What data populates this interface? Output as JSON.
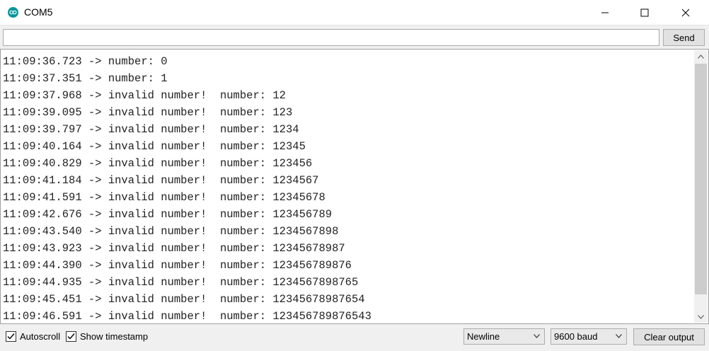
{
  "window": {
    "title": "COM5",
    "icon": "arduino-icon"
  },
  "send": {
    "input_value": "",
    "button_label": "Send"
  },
  "output": {
    "lines": [
      "11:09:36.723 -> number: 0",
      "11:09:37.351 -> number: 1",
      "11:09:37.968 -> invalid number!  number: 12",
      "11:09:39.095 -> invalid number!  number: 123",
      "11:09:39.797 -> invalid number!  number: 1234",
      "11:09:40.164 -> invalid number!  number: 12345",
      "11:09:40.829 -> invalid number!  number: 123456",
      "11:09:41.184 -> invalid number!  number: 1234567",
      "11:09:41.591 -> invalid number!  number: 12345678",
      "11:09:42.676 -> invalid number!  number: 123456789",
      "11:09:43.540 -> invalid number!  number: 1234567898",
      "11:09:43.923 -> invalid number!  number: 12345678987",
      "11:09:44.390 -> invalid number!  number: 123456789876",
      "11:09:44.935 -> invalid number!  number: 1234567898765",
      "11:09:45.451 -> invalid number!  number: 12345678987654",
      "11:09:46.591 -> invalid number!  number: 123456789876543"
    ]
  },
  "footer": {
    "autoscroll_label": "Autoscroll",
    "autoscroll_checked": true,
    "timestamp_label": "Show timestamp",
    "timestamp_checked": true,
    "line_ending": "Newline",
    "baud_rate": "9600 baud",
    "clear_label": "Clear output"
  },
  "colors": {
    "accent": "#00979c",
    "chrome": "#f0f0f0"
  }
}
